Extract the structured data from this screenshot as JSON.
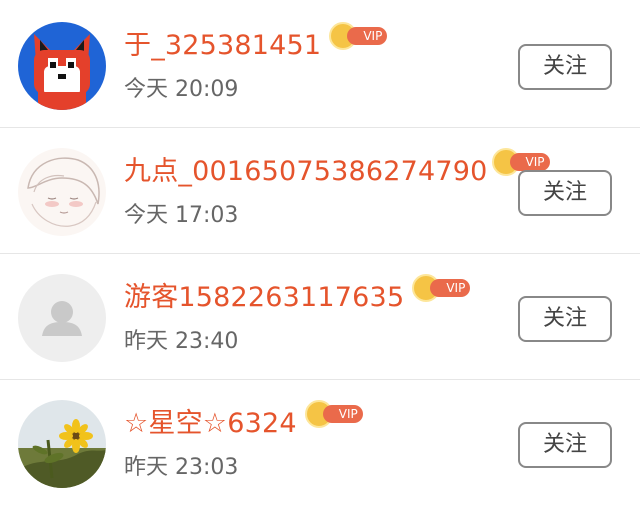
{
  "users": [
    {
      "name": "于_325381451",
      "vip": "VIP",
      "time": "今天 20:09",
      "follow": "关注"
    },
    {
      "name": "九点_00165075386274790",
      "vip": "VIP",
      "time": "今天 17:03",
      "follow": "关注"
    },
    {
      "name": "游客1582263117635",
      "vip": "VIP",
      "time": "昨天 23:40",
      "follow": "关注"
    },
    {
      "name": "☆星空☆6324",
      "vip": "VIP",
      "time": "昨天 23:03",
      "follow": "关注"
    }
  ],
  "colors": {
    "name": "#e5542c",
    "vip_pill": "#ea6a4b",
    "vip_crown": "#f5c445",
    "time": "#666666",
    "divider": "#e6e6e6"
  },
  "icons": [
    "fox-avatar",
    "anime-avatar",
    "default-user-avatar",
    "sunflower-avatar",
    "crown-icon"
  ]
}
